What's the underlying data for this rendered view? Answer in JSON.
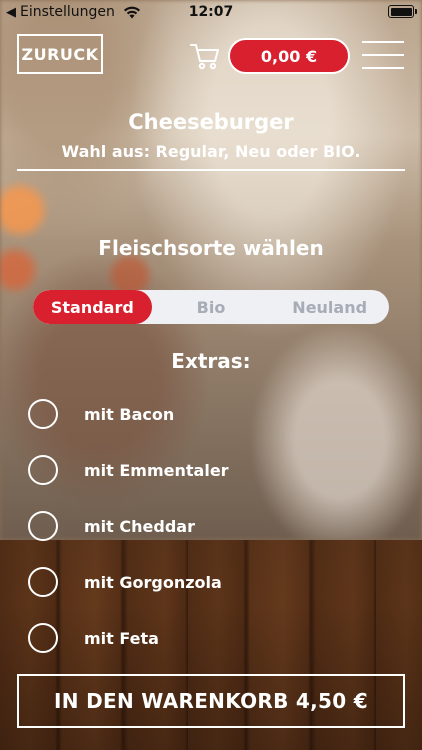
{
  "status_bar": {
    "back_app": "Einstellungen",
    "time": "12:07"
  },
  "header": {
    "back_label": "ZURUCK",
    "cart_total": "0,00 €"
  },
  "product": {
    "title": "Cheeseburger",
    "subtitle": "Wahl aus: Regular, Neu oder BIO."
  },
  "meat": {
    "title": "Fleischsorte wählen",
    "options": [
      "Standard",
      "Bio",
      "Neuland"
    ],
    "selected": "Standard"
  },
  "extras": {
    "title": "Extras:",
    "items": [
      "mit Bacon",
      "mit Emmentaler",
      "mit Cheddar",
      "mit Gorgonzola",
      "mit Feta"
    ]
  },
  "add_to_cart_label": "IN DEN WARENKORB 4,50 €",
  "colors": {
    "accent_red": "#d8202e",
    "segment_bg": "#eef0f3",
    "segment_inactive_text": "#a7acb7"
  }
}
